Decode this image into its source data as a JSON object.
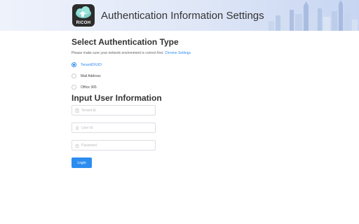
{
  "header": {
    "title": "Authentication Information Settings",
    "logo_text": "RICOH"
  },
  "auth_type": {
    "title": "Select Authentication Type",
    "hint": "Please make sure your network environment is correct first.",
    "hint_link": "Chrome Settings",
    "options": [
      {
        "label": "TenantID/UID",
        "selected": true
      },
      {
        "label": "Mail Address",
        "selected": false
      },
      {
        "label": "Office 365",
        "selected": false
      }
    ]
  },
  "user_info": {
    "title": "Input User Information",
    "tenant_placeholder": "Tenant Id",
    "user_placeholder": "User Id",
    "password_placeholder": "Password",
    "login_label": "Login"
  },
  "colors": {
    "accent": "#2d8cf0"
  }
}
